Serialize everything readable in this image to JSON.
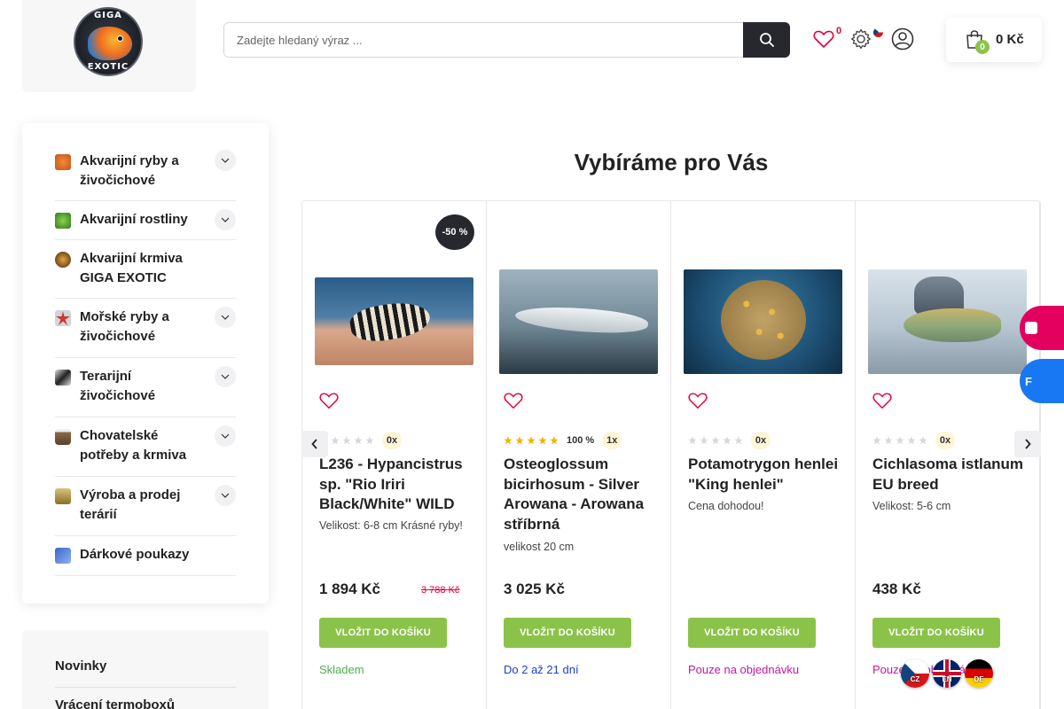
{
  "header": {
    "logo_top": "GIGA",
    "logo_bottom": "EXOTIC",
    "search_placeholder": "Zadejte hledaný výraz ...",
    "wishlist_count": "0",
    "cart_count": "0",
    "cart_total": "0 Kč"
  },
  "sidebar": {
    "categories": [
      {
        "label": "Akvarijní ryby a živočichové",
        "has_toggle": true
      },
      {
        "label": "Akvarijní rostliny",
        "has_toggle": true
      },
      {
        "label": "Akvarijní krmiva GIGA EXOTIC",
        "has_toggle": false
      },
      {
        "label": "Mořské ryby a živočichové",
        "has_toggle": true
      },
      {
        "label": "Terarijní živočichové",
        "has_toggle": true
      },
      {
        "label": "Chovatelské potřeby a krmiva",
        "has_toggle": true
      },
      {
        "label": "Výroba a prodej terárií",
        "has_toggle": true
      },
      {
        "label": "Dárkové poukazy",
        "has_toggle": false
      }
    ],
    "info_links": [
      "Novinky",
      "Vrácení termoboxů"
    ]
  },
  "main": {
    "title": "Vybíráme pro Vás",
    "products": [
      {
        "badge": "-50 %",
        "rating_count": "0x",
        "rating_pct": "",
        "rating_stars": 0,
        "name": "L236 - Hypancistrus sp. \"Rio Iriri Black/White\" WILD",
        "desc": "Velikost: 6-8 cm Krásné ryby!",
        "price": "1 894 Kč",
        "old_price": "3 788 Kč",
        "button": "VLOŽIT DO KOŠÍKU",
        "availability": "Skladem",
        "availability_color": "#4caf50"
      },
      {
        "badge": "",
        "rating_count": "1x",
        "rating_pct": "100 %",
        "rating_stars": 5,
        "name": "Osteoglossum bicirhosum - Silver Arowana - Arowana stříbrná",
        "desc": "velikost 20 cm",
        "price": "3 025 Kč",
        "old_price": "",
        "button": "VLOŽIT DO KOŠÍKU",
        "availability": "Do 2 až 21 dní",
        "availability_color": "#1e3fc9"
      },
      {
        "badge": "",
        "rating_count": "0x",
        "rating_pct": "",
        "rating_stars": 0,
        "name": "Potamotrygon henlei \"King henlei\"",
        "desc": "Cena dohodou!",
        "price": "",
        "old_price": "",
        "button": "VLOŽIT DO KOŠÍKU",
        "availability": "Pouze na objednávku",
        "availability_color": "#c2189a"
      },
      {
        "badge": "",
        "rating_count": "0x",
        "rating_pct": "",
        "rating_stars": 0,
        "name": "Cichlasoma istlanum EU breed",
        "desc": "Velikost: 5-6 cm",
        "price": "438 Kč",
        "old_price": "",
        "button": "VLOŽIT DO KOŠÍKU",
        "availability": "Pouze na objednávku",
        "availability_color": "#c2189a"
      }
    ]
  },
  "floating": {
    "facebook_letter": "F"
  },
  "languages": [
    "CZ",
    "EN",
    "DE"
  ],
  "colors": {
    "accent_green": "#8bc34a",
    "dark": "#26282d",
    "sale_red": "#e4003a",
    "star_gold": "#f5b301"
  }
}
